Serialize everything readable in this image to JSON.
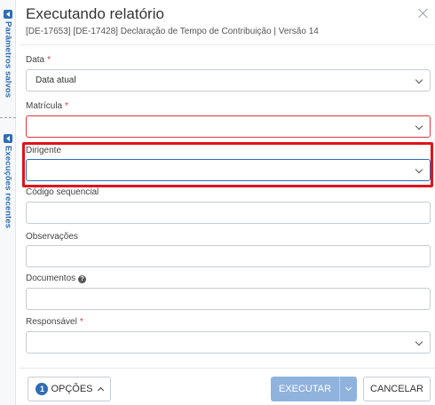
{
  "rail": {
    "saved_params": "Parâmetros salvos",
    "recent_runs": "Execuções recentes"
  },
  "dialog": {
    "title": "Executando relatório",
    "subtitle": "[DE-17653] [DE-17428] Declaração de Tempo de Contribuição | Versão 14"
  },
  "fields": {
    "data": {
      "label": "Data",
      "required": true,
      "value": "Data atual",
      "type": "select"
    },
    "matricula": {
      "label": "Matrícula",
      "required": true,
      "value": "",
      "type": "select",
      "state": "error"
    },
    "dirigente": {
      "label": "Dirigente",
      "required": false,
      "value": "",
      "type": "select",
      "state": "focused"
    },
    "codigo_sequencial": {
      "label": "Código sequencial",
      "required": false,
      "value": "",
      "type": "text"
    },
    "observacoes": {
      "label": "Observações",
      "required": false,
      "value": "",
      "type": "text"
    },
    "documentos": {
      "label": "Documentos",
      "required": false,
      "value": "",
      "type": "text",
      "help_icon": "question-circle-icon"
    },
    "responsavel": {
      "label": "Responsável",
      "required": true,
      "value": "",
      "type": "select"
    }
  },
  "required_mark": "*",
  "footer": {
    "options_count": "1",
    "options_label": "OPÇÕES",
    "execute_label": "EXECUTAR",
    "cancel_label": "CANCELAR"
  },
  "colors": {
    "accent": "#2f6db5",
    "error": "#d9363e",
    "highlight": "#e0131c",
    "execute_disabled": "#8fb3dd"
  }
}
